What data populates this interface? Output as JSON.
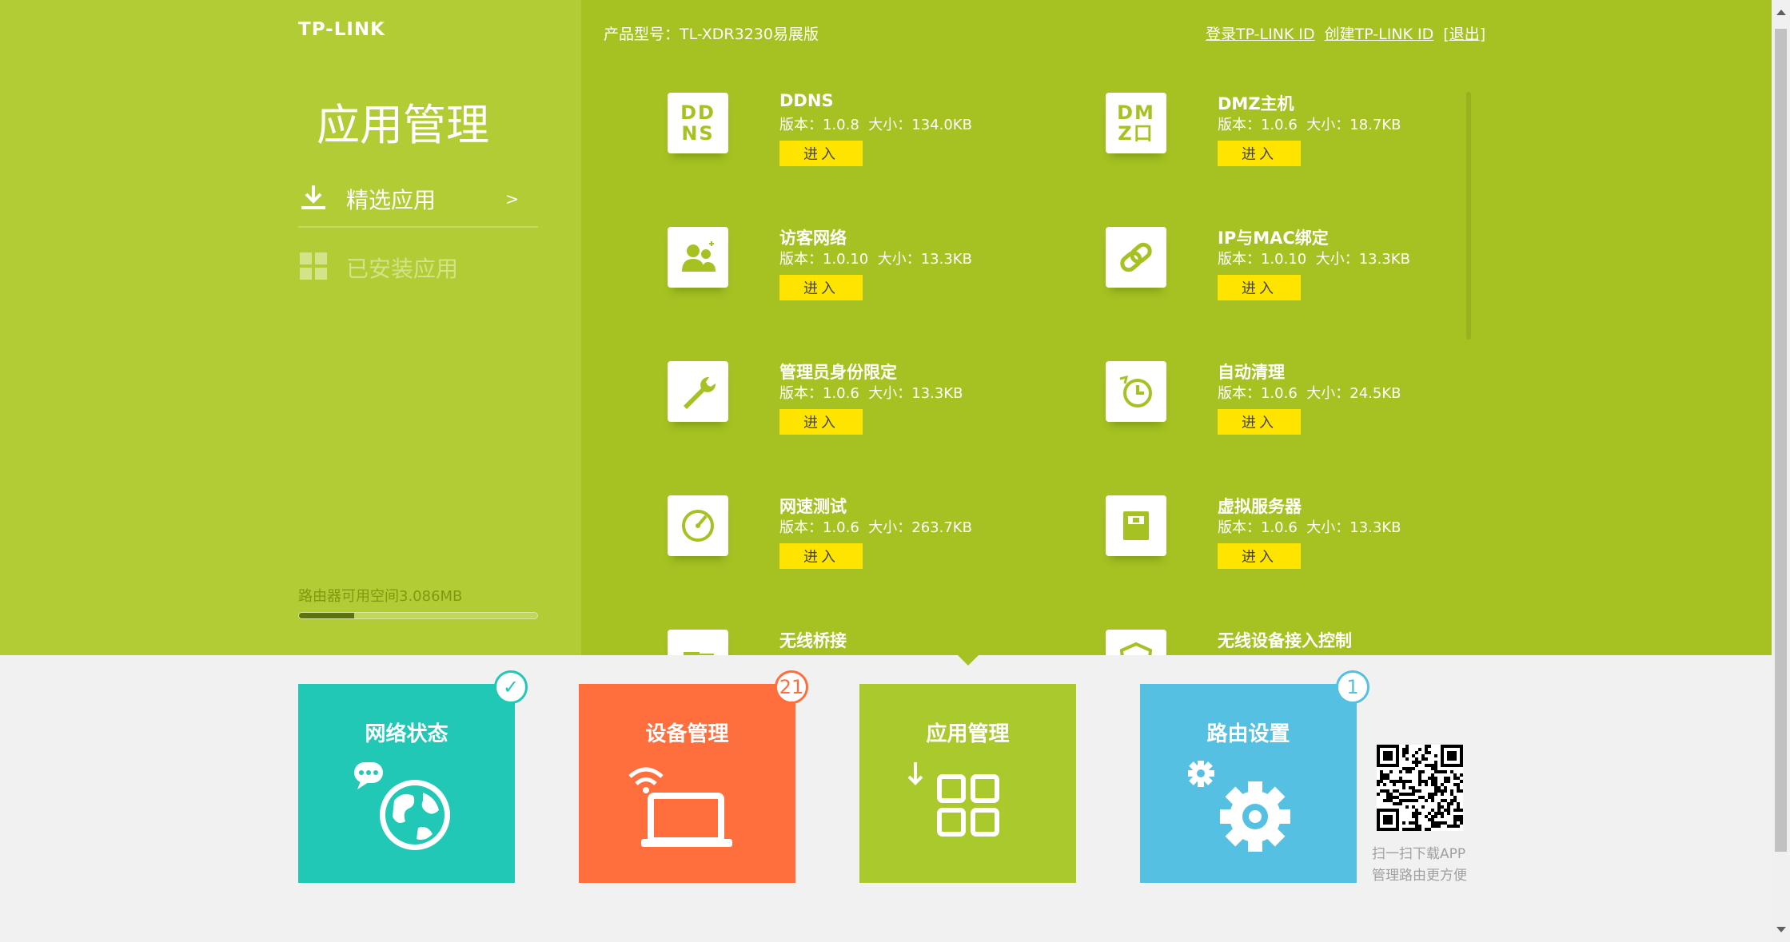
{
  "brand": {
    "logo": "TP-LINK"
  },
  "sidebar": {
    "title": "应用管理",
    "items": [
      {
        "label": "精选应用",
        "arrow": ">"
      },
      {
        "label": "已安装应用"
      }
    ],
    "storage": {
      "label": "路由器可用空间3.086MB",
      "fill_fraction": 0.23
    }
  },
  "header": {
    "model": "产品型号：TL-XDR3230易展版",
    "links": [
      "登录TP-LINK ID",
      "创建TP-LINK ID",
      "[退出]"
    ]
  },
  "apps": [
    {
      "name": "DDNS",
      "version": "1.0.8",
      "size": "134.0KB",
      "icon": "ddns-text-icon",
      "icon_text": "DD\nNS"
    },
    {
      "name": "DMZ主机",
      "version": "1.0.6",
      "size": "18.7KB",
      "icon": "dmz-text-icon",
      "icon_text": "DM\nZ口"
    },
    {
      "name": "访客网络",
      "version": "1.0.10",
      "size": "13.3KB",
      "icon": "guests-icon"
    },
    {
      "name": "IP与MAC绑定",
      "version": "1.0.10",
      "size": "13.3KB",
      "icon": "link-icon"
    },
    {
      "name": "管理员身份限定",
      "version": "1.0.6",
      "size": "13.3KB",
      "icon": "wrench-icon"
    },
    {
      "name": "自动清理",
      "version": "1.0.6",
      "size": "24.5KB",
      "icon": "clock-refresh-icon"
    },
    {
      "name": "网速测试",
      "version": "1.0.6",
      "size": "263.7KB",
      "icon": "speedometer-icon"
    },
    {
      "name": "虚拟服务器",
      "version": "1.0.6",
      "size": "13.3KB",
      "icon": "server-icon"
    },
    {
      "name": "无线桥接",
      "icon": "bridge-icon"
    },
    {
      "name": "无线设备接入控制",
      "icon": "shield-icon"
    }
  ],
  "labels": {
    "version_prefix": "版本：",
    "size_prefix": "大小：",
    "enter": "进入"
  },
  "tiles": [
    {
      "title": "网络状态",
      "badge": "✓",
      "badge_color": "#21c8b6",
      "icon": "globe-chat-icon"
    },
    {
      "title": "设备管理",
      "badge": "21",
      "badge_color": "#ff6e3d",
      "icon": "laptop-wifi-icon"
    },
    {
      "title": "应用管理",
      "icon": "apps-grid-icon"
    },
    {
      "title": "路由设置",
      "badge": "1",
      "badge_color": "#56c0e3",
      "icon": "gears-icon"
    }
  ],
  "qr": {
    "caption_line1": "扫一扫下载APP",
    "caption_line2": "管理路由更方便"
  },
  "colors": {
    "main_green": "#a5c222",
    "sidebar_green": "#b2cc35",
    "enter_yellow": "#ffe400"
  }
}
